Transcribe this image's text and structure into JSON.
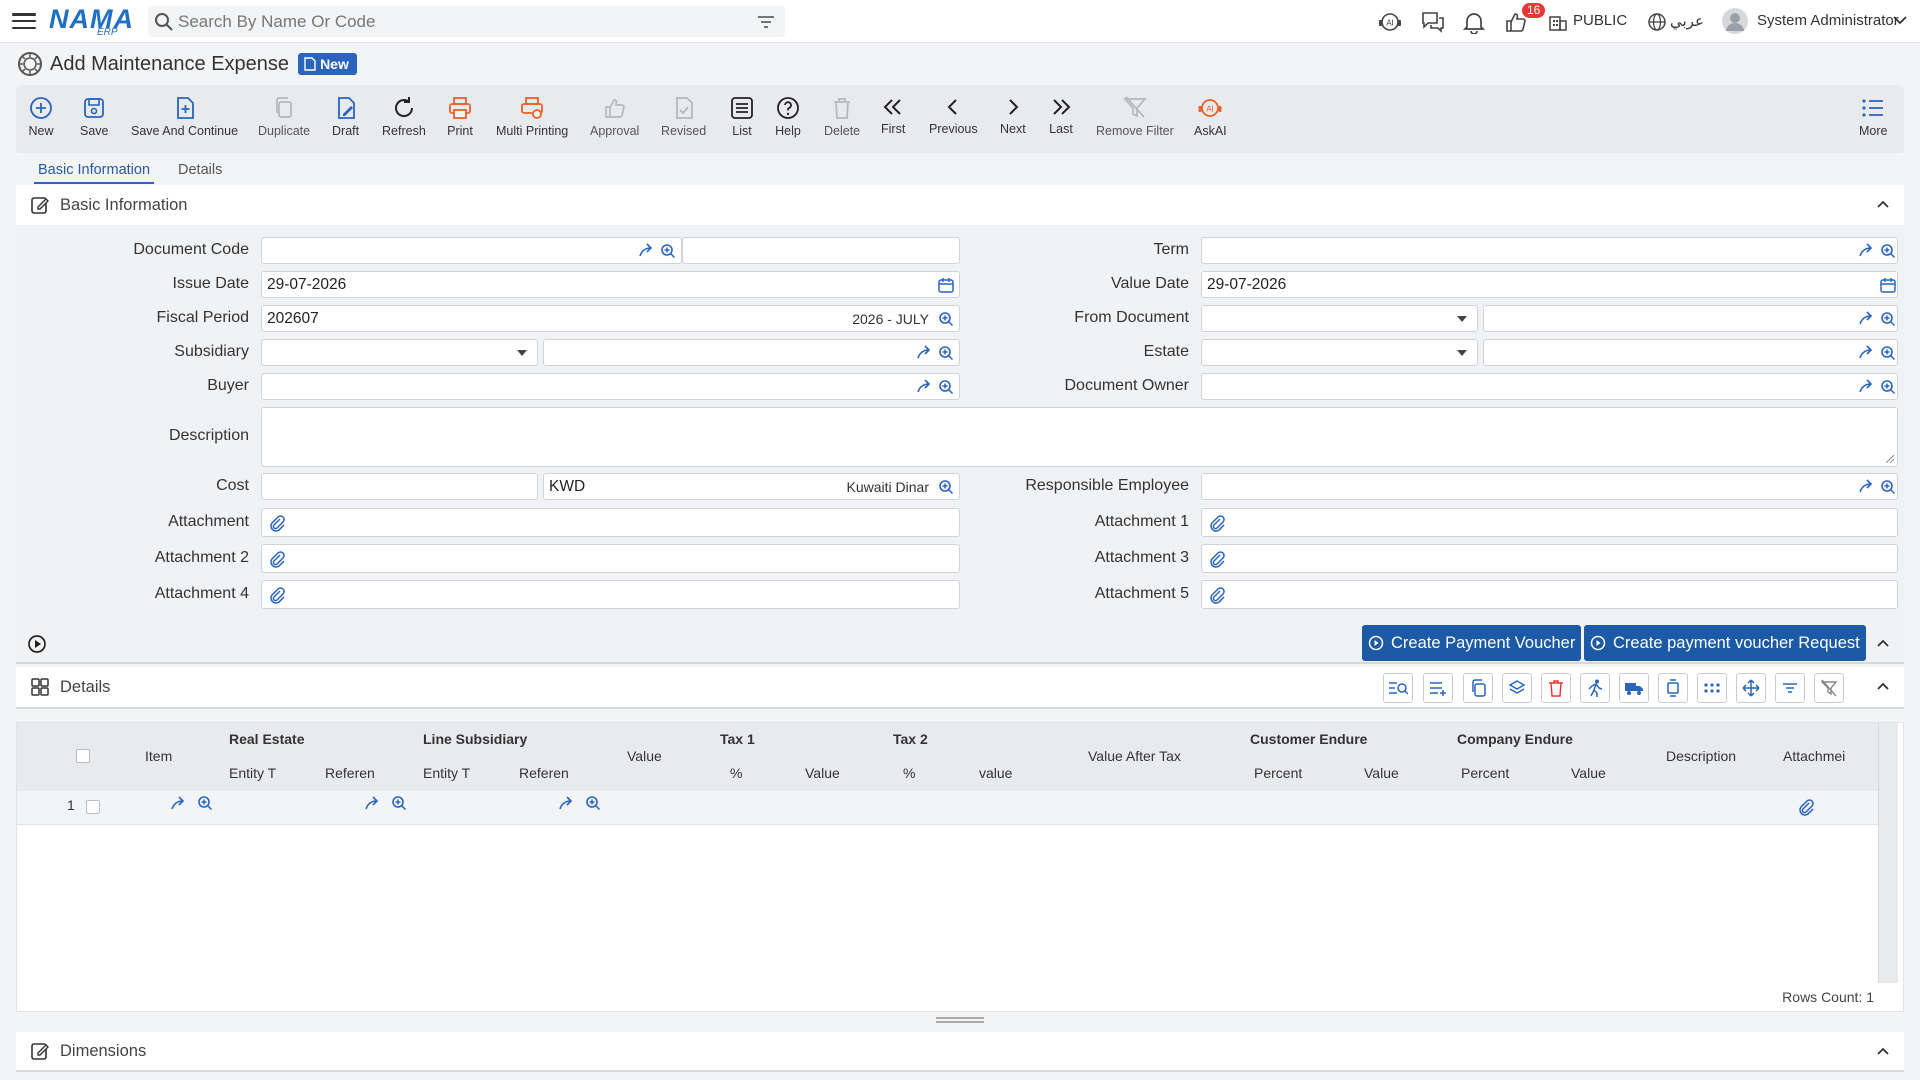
{
  "header": {
    "logo_text": "NAMA",
    "logo_sub": "ERP",
    "search_placeholder": "Search By Name Or Code",
    "notification_count": "16",
    "scope": "PUBLIC",
    "language": "عربي",
    "user": "System Administrator"
  },
  "page": {
    "title": "Add Maintenance Expense",
    "status_badge": "New"
  },
  "toolbar": {
    "new": "New",
    "save": "Save",
    "save_continue": "Save And Continue",
    "duplicate": "Duplicate",
    "draft": "Draft",
    "refresh": "Refresh",
    "print": "Print",
    "multi_print": "Multi Printing",
    "approval": "Approval",
    "revised": "Revised",
    "list": "List",
    "help": "Help",
    "delete": "Delete",
    "first": "First",
    "previous": "Previous",
    "next": "Next",
    "last": "Last",
    "remove_filter": "Remove Filter",
    "askai": "AskAI",
    "more": "More"
  },
  "tabs": {
    "basic": "Basic Information",
    "details": "Details"
  },
  "sections": {
    "basic": "Basic Information",
    "details": "Details",
    "dimensions": "Dimensions"
  },
  "form": {
    "document_code": {
      "label": "Document Code",
      "value": ""
    },
    "term": {
      "label": "Term",
      "value": ""
    },
    "issue_date": {
      "label": "Issue Date",
      "value": "29-07-2026"
    },
    "value_date": {
      "label": "Value Date",
      "value": "29-07-2026"
    },
    "fiscal_period": {
      "label": "Fiscal Period",
      "value": "202607",
      "suffix": "2026 - JULY"
    },
    "from_document": {
      "label": "From Document",
      "value": ""
    },
    "subsidiary": {
      "label": "Subsidiary",
      "value": ""
    },
    "estate": {
      "label": "Estate",
      "value": ""
    },
    "buyer": {
      "label": "Buyer",
      "value": ""
    },
    "document_owner": {
      "label": "Document Owner",
      "value": ""
    },
    "description": {
      "label": "Description",
      "value": ""
    },
    "cost": {
      "label": "Cost",
      "value": "",
      "currency": "KWD",
      "currency_name": "Kuwaiti Dinar"
    },
    "responsible_employee": {
      "label": "Responsible Employee",
      "value": ""
    },
    "attachment": {
      "label": "Attachment"
    },
    "attachment1": {
      "label": "Attachment 1"
    },
    "attachment2": {
      "label": "Attachment 2"
    },
    "attachment3": {
      "label": "Attachment 3"
    },
    "attachment4": {
      "label": "Attachment 4"
    },
    "attachment5": {
      "label": "Attachment 5"
    }
  },
  "actions": {
    "create_pv": "Create Payment Voucher",
    "create_pv_request": "Create payment voucher Request"
  },
  "grid": {
    "item": "Item",
    "real_estate": "Real Estate",
    "line_subsidiary": "Line Subsidiary",
    "entity_type": "Entity T",
    "reference": "Referen",
    "value": "Value",
    "tax1": "Tax 1",
    "tax2": "Tax 2",
    "percent_sym": "%",
    "value_lower": "value",
    "value_after_tax": "Value After Tax",
    "customer_endure": "Customer Endure",
    "company_endure": "Company Endure",
    "percent": "Percent",
    "description": "Description",
    "attachment": "Attachmei",
    "row_number": "1",
    "rows_count": "Rows Count: 1"
  },
  "colors": {
    "primary": "#1c5aa6",
    "accent_orange": "#e8622c",
    "badge_red": "#e53935"
  }
}
